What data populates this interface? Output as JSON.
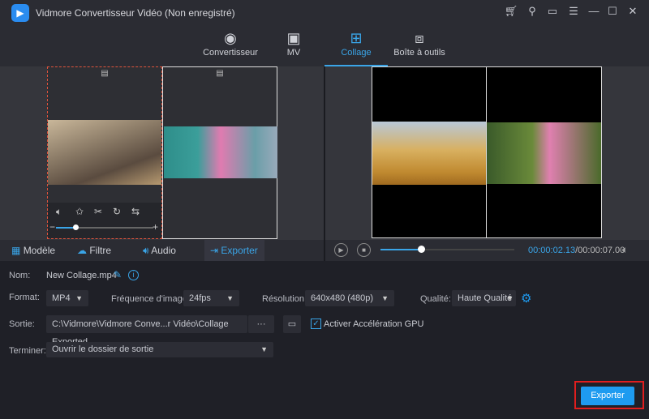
{
  "app": {
    "title": "Vidmore Convertisseur Vidéo (Non enregistré)"
  },
  "nav": {
    "tabs": [
      {
        "label": "Convertisseur",
        "icon": "convert-icon"
      },
      {
        "label": "MV",
        "icon": "mv-icon"
      },
      {
        "label": "Collage",
        "icon": "collage-icon",
        "active": true
      },
      {
        "label": "Boîte à outils",
        "icon": "toolbox-icon"
      }
    ]
  },
  "bottom_tabs": [
    {
      "label": "Modèle"
    },
    {
      "label": "Filtre"
    },
    {
      "label": "Audio"
    },
    {
      "label": "Exporter",
      "active": true
    }
  ],
  "player": {
    "current": "00:00:02.13",
    "total": "/00:00:07.00",
    "progress": 0.3
  },
  "clip_volume": 0.2,
  "settings": {
    "name_label": "Nom:",
    "name_value": "New Collage.mp4",
    "format_label": "Format:",
    "format_value": "MP4",
    "fps_label": "Fréquence d'image:",
    "fps_value": "24fps",
    "resolution_label": "Résolution:",
    "resolution_value": "640x480 (480p)",
    "quality_label": "Qualité:",
    "quality_value": "Haute Qualité",
    "output_label": "Sortie:",
    "output_value": "C:\\Vidmore\\Vidmore Conve...r Vidéo\\Collage Exported",
    "browse_label": "···",
    "gpu_label": "Activer Accélération GPU",
    "gpu_checked": true,
    "finish_label": "Terminer:",
    "finish_value": "Ouvrir le dossier de sortie"
  },
  "export_label": "Exporter",
  "colors": {
    "accent": "#3aa5e8",
    "highlight": "#e01e1e"
  }
}
